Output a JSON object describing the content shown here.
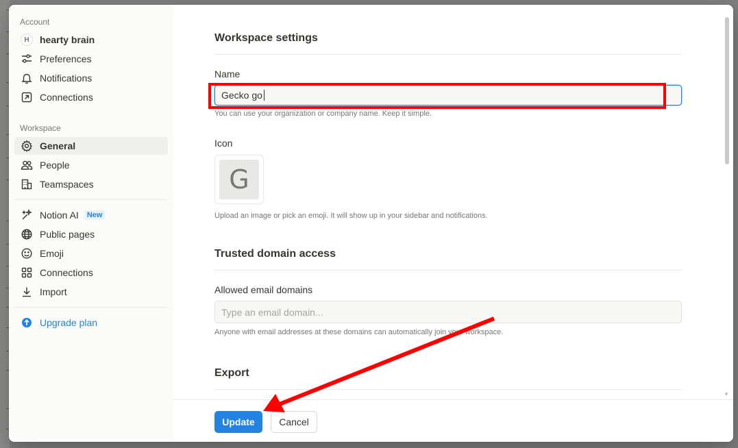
{
  "sidebar": {
    "account_label": "Account",
    "user": {
      "initial": "H",
      "name": "hearty brain"
    },
    "account_items": [
      {
        "label": "Preferences",
        "icon": "sliders-icon"
      },
      {
        "label": "Notifications",
        "icon": "bell-icon"
      },
      {
        "label": "Connections",
        "icon": "arrow-up-right-box-icon"
      }
    ],
    "workspace_label": "Workspace",
    "workspace_items": [
      {
        "label": "General",
        "icon": "gear-icon",
        "active": true
      },
      {
        "label": "People",
        "icon": "people-icon"
      },
      {
        "label": "Teamspaces",
        "icon": "building-icon"
      }
    ],
    "feature_items": [
      {
        "label": "Notion AI",
        "icon": "ai-sparkle-icon",
        "badge": "New"
      },
      {
        "label": "Public pages",
        "icon": "globe-icon"
      },
      {
        "label": "Emoji",
        "icon": "smiley-icon"
      },
      {
        "label": "Connections",
        "icon": "grid-icon"
      },
      {
        "label": "Import",
        "icon": "download-icon"
      }
    ],
    "upgrade_label": "Upgrade plan",
    "accent_color": "#2383e2"
  },
  "main": {
    "workspace_settings_title": "Workspace settings",
    "name_label": "Name",
    "name_value": "Gecko go",
    "name_help": "You can use your organization or company name. Keep it simple.",
    "icon_label": "Icon",
    "icon_letter": "G",
    "icon_help": "Upload an image or pick an emoji. It will show up in your sidebar and notifications.",
    "trusted_title": "Trusted domain access",
    "allowed_label": "Allowed email domains",
    "domain_placeholder": "Type an email domain...",
    "domain_help": "Anyone with email addresses at these domains can automatically join your workspace.",
    "export_title": "Export"
  },
  "footer": {
    "update_label": "Update",
    "cancel_label": "Cancel"
  },
  "annotations": {
    "highlight_color": "#ff0000"
  }
}
